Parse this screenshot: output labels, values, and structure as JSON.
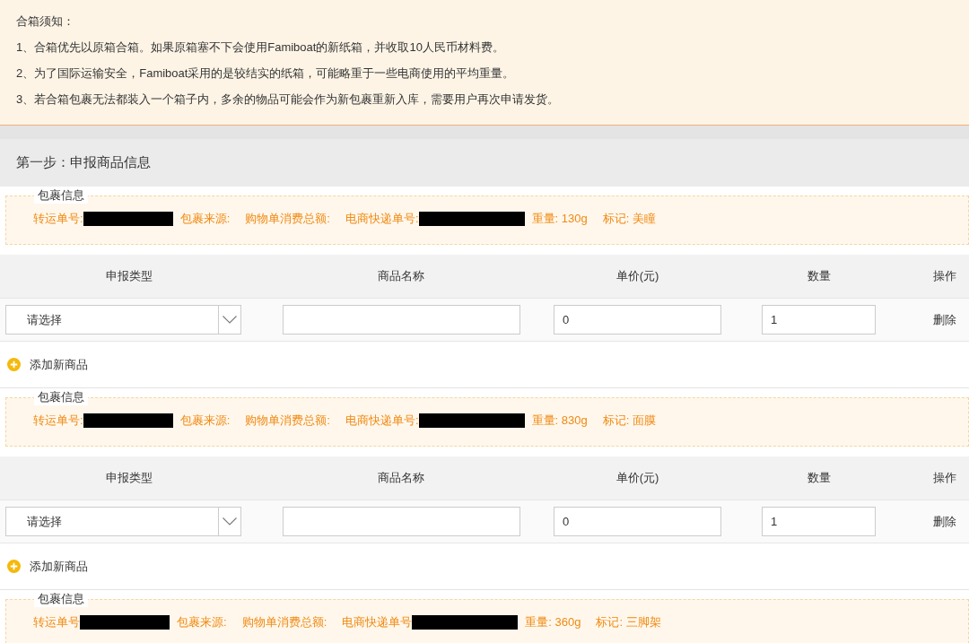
{
  "notice": {
    "title": "合箱须知：",
    "items": [
      "1、合箱优先以原箱合箱。如果原箱塞不下会使用Famiboat的新纸箱，并收取10人民币材料费。",
      "2、为了国际运输安全，Famiboat采用的是较结实的纸箱，可能略重于一些电商使用的平均重量。",
      "3、若合箱包裹无法都装入一个箱子内，多余的物品可能会作为新包裹重新入库，需要用户再次申请发货。"
    ]
  },
  "step": {
    "title": "第一步：申报商品信息"
  },
  "parcels": [
    {
      "legend": "包裹信息",
      "fields": [
        {
          "label": "转运单号:",
          "redacted": true
        },
        {
          "label": "包裹来源:",
          "redacted": false
        },
        {
          "label": "购物单消费总额:",
          "redacted": false
        },
        {
          "label": "电商快递单号:",
          "redacted": true
        },
        {
          "label": "重量: 130g",
          "redacted": false
        },
        {
          "label": "标记: 美瞳",
          "redacted": false
        }
      ],
      "table": {
        "columns": [
          "申报类型",
          "商品名称",
          "单价(元)",
          "数量",
          "操作"
        ],
        "rows": [
          {
            "type_select": "请选择",
            "price": "0",
            "quantity": "1",
            "action": "删除"
          }
        ]
      },
      "add_button": "添加新商品"
    },
    {
      "legend": "包裹信息",
      "fields": [
        {
          "label": "转运单号:",
          "redacted": true
        },
        {
          "label": "包裹来源:",
          "redacted": false
        },
        {
          "label": "购物单消费总额:",
          "redacted": false
        },
        {
          "label": "电商快递单号:",
          "redacted": true
        },
        {
          "label": "重量: 830g",
          "redacted": false
        },
        {
          "label": "标记: 面膜",
          "redacted": false
        }
      ],
      "table": {
        "columns": [
          "申报类型",
          "商品名称",
          "单价(元)",
          "数量",
          "操作"
        ],
        "rows": [
          {
            "type_select": "请选择",
            "price": "0",
            "quantity": "1",
            "action": "删除"
          }
        ]
      },
      "add_button": "添加新商品"
    },
    {
      "legend": "包裹信息",
      "fields": [
        {
          "label": "转运单号",
          "redacted": true
        },
        {
          "label": "包裹来源:",
          "redacted": false
        },
        {
          "label": "购物单消费总额:",
          "redacted": false
        },
        {
          "label": "电商快递单号",
          "redacted": true
        },
        {
          "label": "重量: 360g",
          "redacted": false
        },
        {
          "label": "标记: 三脚架",
          "redacted": false
        }
      ]
    }
  ]
}
